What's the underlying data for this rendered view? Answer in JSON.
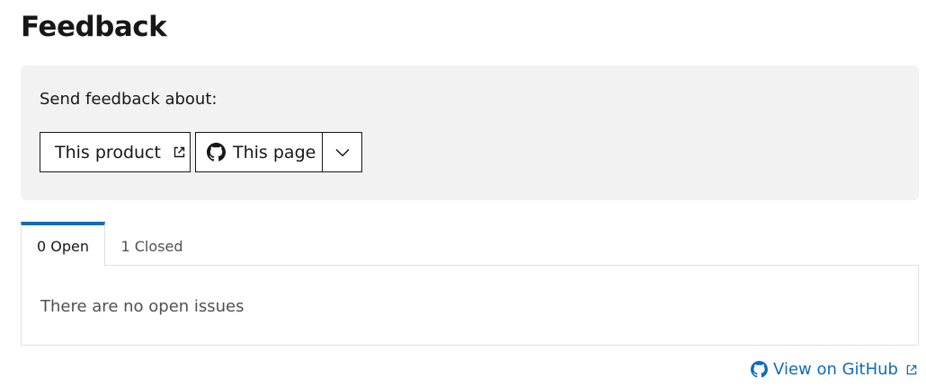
{
  "page": {
    "title": "Feedback"
  },
  "feedback_panel": {
    "label": "Send feedback about:",
    "product_button": {
      "label": "This product",
      "icon": "external-link-icon"
    },
    "page_button": {
      "label": "This page",
      "icon": "github-icon"
    },
    "dropdown_button": {
      "icon": "chevron-down-icon"
    }
  },
  "tabs": [
    {
      "label": "0 Open",
      "selected": true
    },
    {
      "label": "1 Closed",
      "selected": false
    }
  ],
  "issues": {
    "empty_message": "There are no open issues"
  },
  "footer": {
    "github_link": "View on GitHub",
    "icon": "github-icon"
  },
  "colors": {
    "accent": "#0f6cbd",
    "panel_bg": "#f2f2f2",
    "text": "#171717",
    "muted": "#505050",
    "border": "#e0e0e0"
  }
}
